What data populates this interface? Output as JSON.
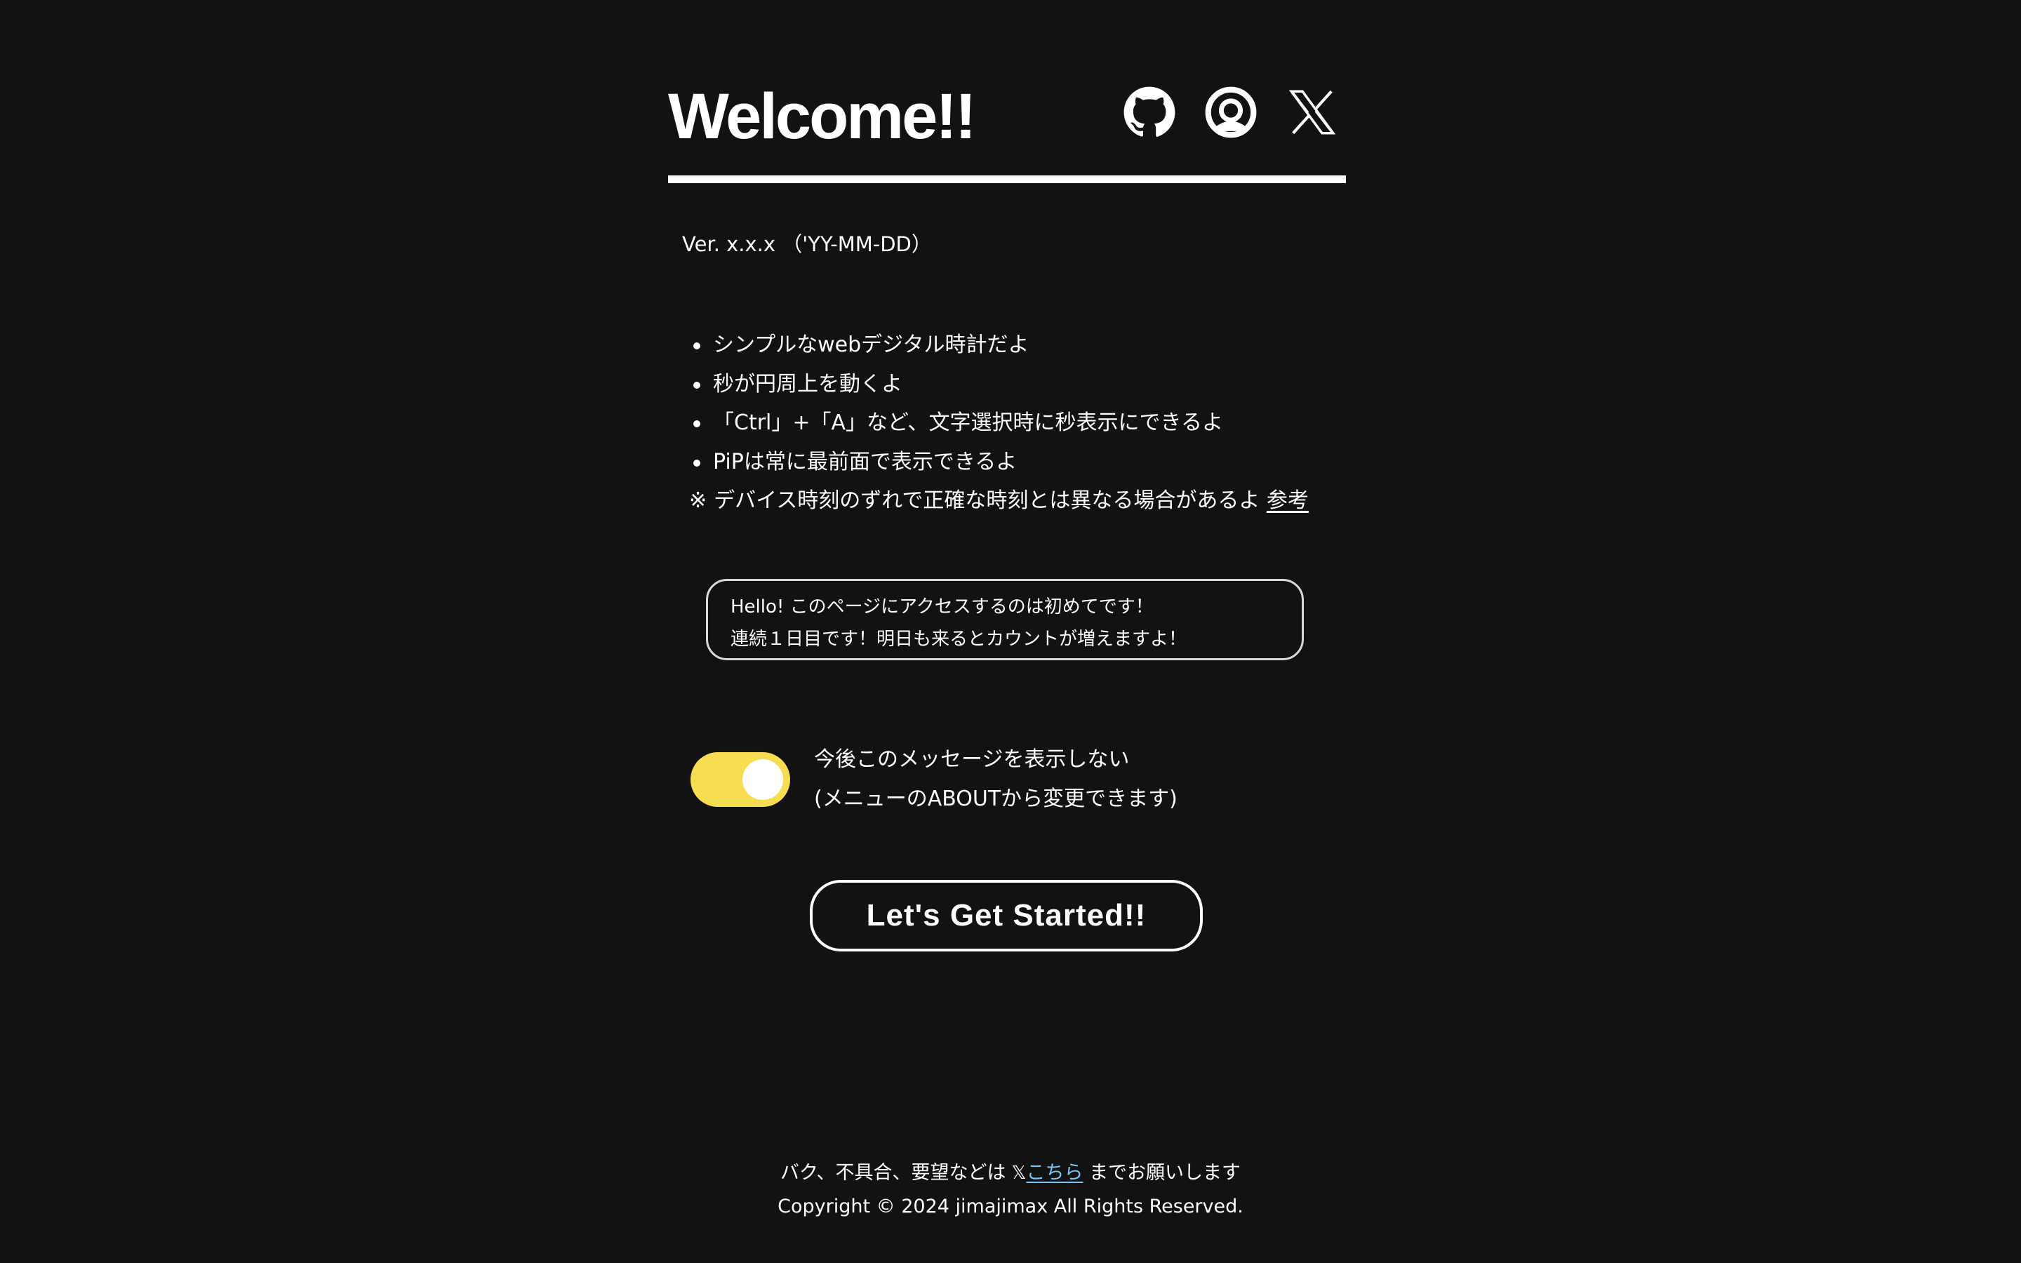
{
  "header": {
    "title": "Welcome!!",
    "icons": [
      "github-icon",
      "misskey-icon",
      "x-icon"
    ]
  },
  "version": "Ver. x.x.x （'YY-MM-DD）",
  "features": {
    "items": [
      "シンプルなwebデジタル時計だよ",
      "秒が円周上を動くよ",
      "「Ctrl」+「A」など、文字選択時に秒表示にできるよ",
      "PiPは常に最前面で表示できるよ"
    ],
    "note_mark": "※",
    "note_text": "デバイス時刻のずれで正確な時刻とは異なる場合があるよ",
    "note_link": "参考"
  },
  "greeting": {
    "line1": "Hello! このページにアクセスするのは初めてです！",
    "line2": "連続１日目です！明日も来るとカウントが増えますよ！"
  },
  "toggle": {
    "checked": true,
    "line1": "今後このメッセージを表示しない",
    "line2": "(メニューのABOUTから変更できます)"
  },
  "cta": {
    "label": "Let's Get Started!!"
  },
  "footer": {
    "contact_prefix": "バク、不具合、要望などは",
    "contact_x": "𝕏",
    "contact_link": "こちら",
    "contact_suffix": "までお願いします",
    "copyright": "Copyright © 2024 jimajimax All Rights Reserved."
  },
  "colors": {
    "background": "#121212",
    "toggle_on": "#f6dd52",
    "link": "#7cc6f5"
  }
}
